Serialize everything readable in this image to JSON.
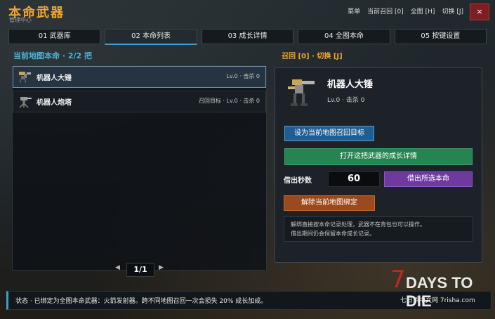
{
  "header": {
    "title": "本命武器",
    "subtitle": "管理中心",
    "hotkeys": [
      "菜单",
      "当前召回 [0]",
      "全图 [H]",
      "切换 [J]"
    ],
    "close_label": "×"
  },
  "tabs": [
    {
      "label": "01 武器库",
      "active": false
    },
    {
      "label": "02 本命列表",
      "active": true
    },
    {
      "label": "03 成长详情",
      "active": false
    },
    {
      "label": "04 全图本命",
      "active": false
    },
    {
      "label": "05 按键设置",
      "active": false
    }
  ],
  "list": {
    "section_title": "当前地图本命 · 2/2 把",
    "items": [
      {
        "name": "机器人大锤",
        "meta": "Lv.0 · 击杀 0",
        "selected": true,
        "icon": "robotic-sledge-icon"
      },
      {
        "name": "机器人炮塔",
        "meta": "召回目标 · Lv.0 · 击杀 0",
        "selected": false,
        "icon": "robotic-turret-icon"
      }
    ],
    "pager": {
      "prev": "◀",
      "page": "1/1",
      "next": "▶"
    }
  },
  "detail": {
    "recall_hint": "召回 [0] · 切换 [J]",
    "name": "机器人大锤",
    "meta": "Lv.0 · 击杀 0",
    "icon": "robotic-sledge-icon",
    "set_recall_label": "设为当前地图召回目标",
    "open_growth_label": "打开这把武器的成长详情",
    "lend_label": "借出秒数",
    "lend_value": "60",
    "lend_button_label": "借出所选本命",
    "unbind_label": "解除当前地图绑定",
    "note_lines": [
      "解绑直接按本命记录处理，武器不在背包也可以操作。",
      "借出期间仍会保留本命成长记录。"
    ]
  },
  "status": {
    "text": "状态 · 已绑定为全图本命武器：火箭发射器。跨不同地图召回一次会损失 20% 成长加成。"
  },
  "watermark": {
    "seven": "7",
    "text": "DAYS TO DIE",
    "sub": "七日杀中文网 7risha.com"
  },
  "colors": {
    "accent_orange": "#f0a530",
    "accent_blue": "#4cb3d8",
    "btn_blue": "#1f5e93",
    "btn_green": "#278352",
    "btn_purple": "#6e3aa0",
    "btn_orange": "#9c4a1c",
    "close_red": "#7e1e22"
  }
}
